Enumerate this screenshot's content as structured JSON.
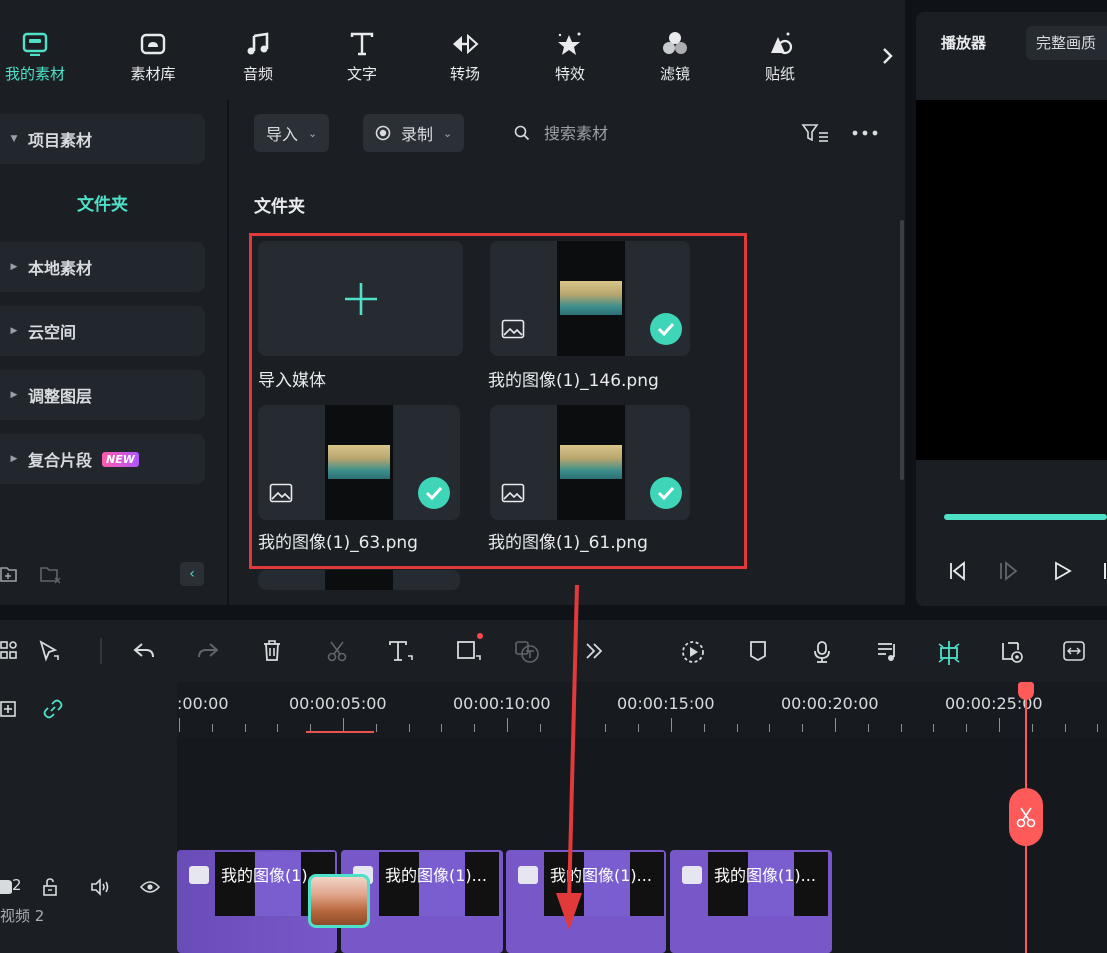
{
  "categories": [
    {
      "label": "我的素材",
      "icon": "my-media-icon",
      "active": true
    },
    {
      "label": "素材库",
      "icon": "stock-library-icon"
    },
    {
      "label": "音频",
      "icon": "audio-icon"
    },
    {
      "label": "文字",
      "icon": "text-icon"
    },
    {
      "label": "转场",
      "icon": "transition-icon"
    },
    {
      "label": "特效",
      "icon": "effects-icon"
    },
    {
      "label": "滤镜",
      "icon": "filters-icon"
    },
    {
      "label": "贴纸",
      "icon": "stickers-icon"
    }
  ],
  "sidebar": {
    "project_media": "项目素材",
    "folder": "文件夹",
    "items": [
      "本地素材",
      "云空间",
      "调整图层",
      "复合片段"
    ],
    "new_badge": "NEW"
  },
  "media_toolbar": {
    "import_label": "导入",
    "record_label": "录制",
    "search_placeholder": "搜索素材"
  },
  "media": {
    "folder_title": "文件夹",
    "import_card_label": "导入媒体",
    "files": [
      "我的图像(1)_146.png",
      "我的图像(1)_63.png",
      "我的图像(1)_61.png"
    ]
  },
  "player": {
    "tab_label": "播放器",
    "quality_label": "完整画质"
  },
  "ruler": {
    "labels": [
      ":00:00",
      "00:00:05:00",
      "00:00:10:00",
      "00:00:15:00",
      "00:00:20:00",
      "00:00:25:00"
    ]
  },
  "track": {
    "number": "2",
    "name": "视频 2",
    "clips": [
      "我的图像(1)...",
      "我的图像(1)...",
      "我的图像(1)...",
      "我的图像(1)..."
    ]
  },
  "colors": {
    "accent": "#4fe0c8",
    "highlight": "#e23a3a",
    "playhead": "#ff5a5a",
    "clip": "#7858c8"
  }
}
